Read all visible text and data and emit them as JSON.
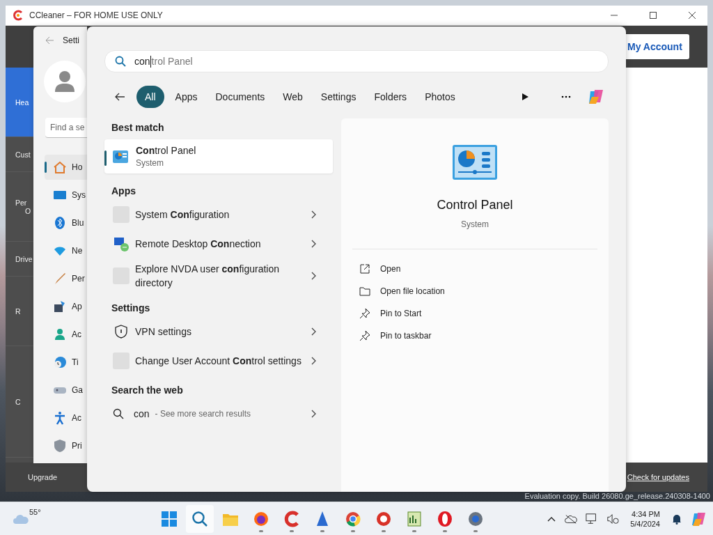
{
  "desktop": {
    "watermark": "Evaluation copy. Build 26080.ge_release.240308-1400"
  },
  "ccleaner": {
    "title": "CCleaner – FOR HOME USE ONLY",
    "account_button": "My Account",
    "sidebar": [
      {
        "lines": [
          "Hea"
        ],
        "selected": true
      },
      {
        "lines": [
          "Cust"
        ],
        "selected": false
      },
      {
        "lines": [
          "Per",
          "O"
        ],
        "selected": false
      },
      {
        "lines": [
          "Drive"
        ],
        "selected": false
      },
      {
        "lines": [
          "R"
        ],
        "selected": false
      },
      {
        "lines": [
          "C"
        ],
        "selected": false
      }
    ],
    "upgrade": "Upgrade",
    "check_updates": "Check for updates"
  },
  "settings": {
    "title": "Setti",
    "search_placeholder": "Find a se",
    "nav": [
      {
        "label": "Ho",
        "selected": true
      },
      {
        "label": "Sys",
        "selected": false
      },
      {
        "label": "Blu",
        "selected": false
      },
      {
        "label": "Ne",
        "selected": false
      },
      {
        "label": "Per",
        "selected": false
      },
      {
        "label": "Ap",
        "selected": false
      },
      {
        "label": "Ac",
        "selected": false
      },
      {
        "label": "Ti",
        "selected": false
      },
      {
        "label": "Ga",
        "selected": false
      },
      {
        "label": "Ac",
        "selected": false
      },
      {
        "label": "Pri",
        "selected": false
      }
    ]
  },
  "search": {
    "value": "con",
    "suggestion": "trol Panel",
    "filters": [
      {
        "label": "All",
        "selected": true
      },
      {
        "label": "Apps",
        "selected": false
      },
      {
        "label": "Documents",
        "selected": false
      },
      {
        "label": "Web",
        "selected": false
      },
      {
        "label": "Settings",
        "selected": false
      },
      {
        "label": "Folders",
        "selected": false
      },
      {
        "label": "Photos",
        "selected": false
      }
    ],
    "best_match": {
      "heading": "Best match",
      "title": "**Con**trol Panel",
      "subtitle": "System",
      "selected": true
    },
    "sections": [
      {
        "heading": "Apps",
        "items": [
          {
            "title": "System **Con**figuration"
          },
          {
            "title": "Remote Desktop **Con**nection"
          },
          {
            "title": "Explore NVDA user **con**figuration directory"
          }
        ]
      },
      {
        "heading": "Settings",
        "items": [
          {
            "title": "VPN settings"
          },
          {
            "title": "Change User Account **Con**trol settings"
          }
        ]
      }
    ],
    "web": {
      "heading": "Search the web",
      "query": "con",
      "hint": "- See more search results"
    },
    "preview": {
      "title": "Control Panel",
      "subtitle": "System",
      "actions": [
        "Open",
        "Open file location",
        "Pin to Start",
        "Pin to taskbar"
      ]
    }
  },
  "taskbar": {
    "weather": "55°",
    "apps": [
      {
        "selected": false,
        "running": false
      },
      {
        "selected": true,
        "running": false
      },
      {
        "selected": false,
        "running": false
      },
      {
        "selected": false,
        "running": true
      },
      {
        "selected": false,
        "running": true
      },
      {
        "selected": false,
        "running": true
      },
      {
        "selected": false,
        "running": true
      },
      {
        "selected": false,
        "running": true
      },
      {
        "selected": false,
        "running": true
      },
      {
        "selected": false,
        "running": true
      },
      {
        "selected": false,
        "running": true
      }
    ],
    "time": "4:34 PM",
    "date": "5/4/2024"
  }
}
